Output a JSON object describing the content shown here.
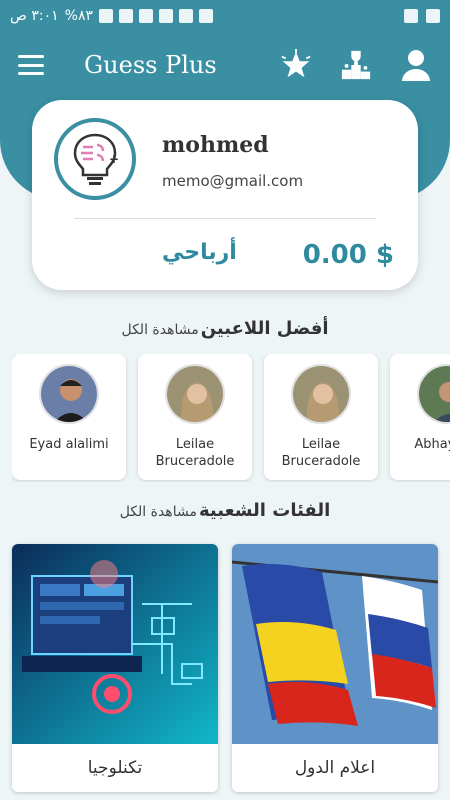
{
  "status_bar": {
    "time": "٣:٠١ ص",
    "battery": "%٨٣"
  },
  "app_bar": {
    "title": "Guess Plus",
    "icons": [
      "menu-icon",
      "star-burst-icon",
      "trophy-podium-icon",
      "person-icon"
    ]
  },
  "profile": {
    "name": "mohmed",
    "email": "memo@gmail.com",
    "balance": "0.00 $",
    "earnings_label": "أرباحي"
  },
  "top_players": {
    "title": "أفضل اللاعبين",
    "see_all": "مشاهدة الكل",
    "items": [
      {
        "name": "Eyad alalimi"
      },
      {
        "name": "Leilae Bruceradole"
      },
      {
        "name": "Leilae Bruceradole"
      },
      {
        "name": "Abhay Sin"
      }
    ]
  },
  "categories": {
    "title": "الفئات الشعبية",
    "see_all": "مشاهدة الكل",
    "items": [
      {
        "label": "تكنلوجيا"
      },
      {
        "label": "اعلام الدول"
      }
    ]
  },
  "colors": {
    "primary": "#3a8fa3",
    "accent_text": "#2f8a9f"
  }
}
